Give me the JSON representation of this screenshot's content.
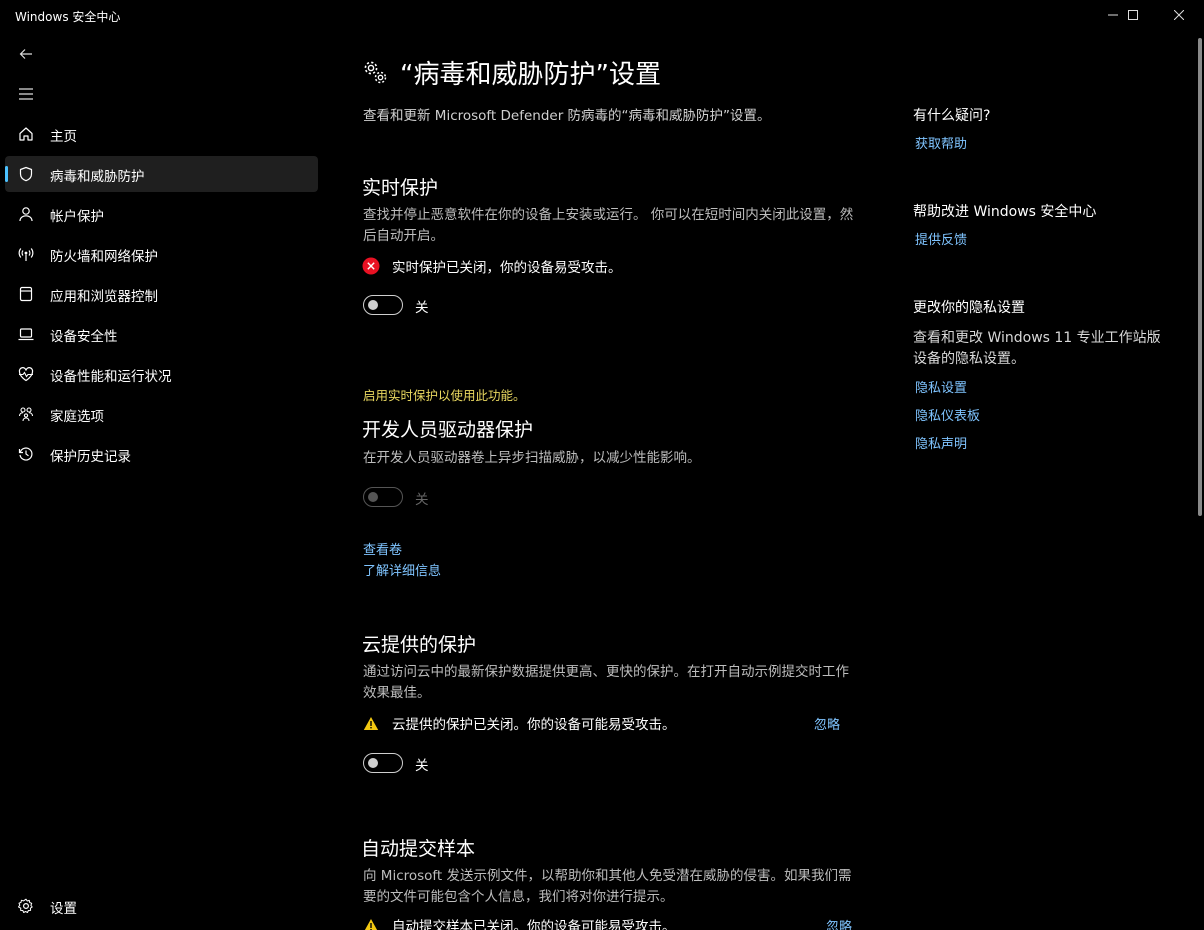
{
  "window": {
    "title": "Windows 安全中心"
  },
  "sidebar": {
    "items": [
      {
        "label": "主页",
        "icon": "home-icon"
      },
      {
        "label": "病毒和威胁防护",
        "icon": "shield-icon",
        "selected": true
      },
      {
        "label": "帐户保护",
        "icon": "person-icon"
      },
      {
        "label": "防火墙和网络保护",
        "icon": "wifi-signal-icon"
      },
      {
        "label": "应用和浏览器控制",
        "icon": "app-window-icon"
      },
      {
        "label": "设备安全性",
        "icon": "laptop-icon"
      },
      {
        "label": "设备性能和运行状况",
        "icon": "heart-pulse-icon"
      },
      {
        "label": "家庭选项",
        "icon": "family-icon"
      },
      {
        "label": "保护历史记录",
        "icon": "history-icon"
      }
    ],
    "settings_label": "设置"
  },
  "main": {
    "title": "“病毒和威胁防护”设置",
    "subtitle": "查看和更新 Microsoft Defender 防病毒的“病毒和威胁防护”设置。",
    "realtime": {
      "title": "实时保护",
      "description": "查找并停止恶意软件在你的设备上安装或运行。 你可以在短时间内关闭此设置，然后自动开启。",
      "status": "实时保护已关闭，你的设备易受攻击。",
      "toggle_label": "关"
    },
    "devdrive": {
      "notice": "启用实时保护以使用此功能。",
      "title": "开发人员驱动器保护",
      "description": "在开发人员驱动器卷上异步扫描威胁，以减少性能影响。",
      "toggle_label": "关",
      "link_volumes": "查看卷",
      "link_learn_more": "了解详细信息"
    },
    "cloud": {
      "title": "云提供的保护",
      "description": "通过访问云中的最新保护数据提供更高、更快的保护。在打开自动示例提交时工作效果最佳。",
      "status": "云提供的保护已关闭。你的设备可能易受攻击。",
      "dismiss": "忽略",
      "toggle_label": "关"
    },
    "autosample": {
      "title": "自动提交样本",
      "description": "向 Microsoft 发送示例文件，以帮助你和其他人免受潜在威胁的侵害。如果我们需要的文件可能包含个人信息，我们将对你进行提示。",
      "status": "自动提交样本已关闭。你的设备可能易受攻击。",
      "dismiss": "忽略"
    }
  },
  "right": {
    "question_title": "有什么疑问?",
    "get_help": "获取帮助",
    "improve_title": "帮助改进 Windows 安全中心",
    "feedback": "提供反馈",
    "privacy_title": "更改你的隐私设置",
    "privacy_desc": "查看和更改 Windows 11 专业工作站版 设备的隐私设置。",
    "privacy_settings": "隐私设置",
    "privacy_dashboard": "隐私仪表板",
    "privacy_statement": "隐私声明"
  },
  "colors": {
    "accent": "#4cc2ff",
    "link": "#7fc4ff",
    "warning": "#f2c811",
    "error": "#e81123",
    "notice": "#e9d860"
  }
}
